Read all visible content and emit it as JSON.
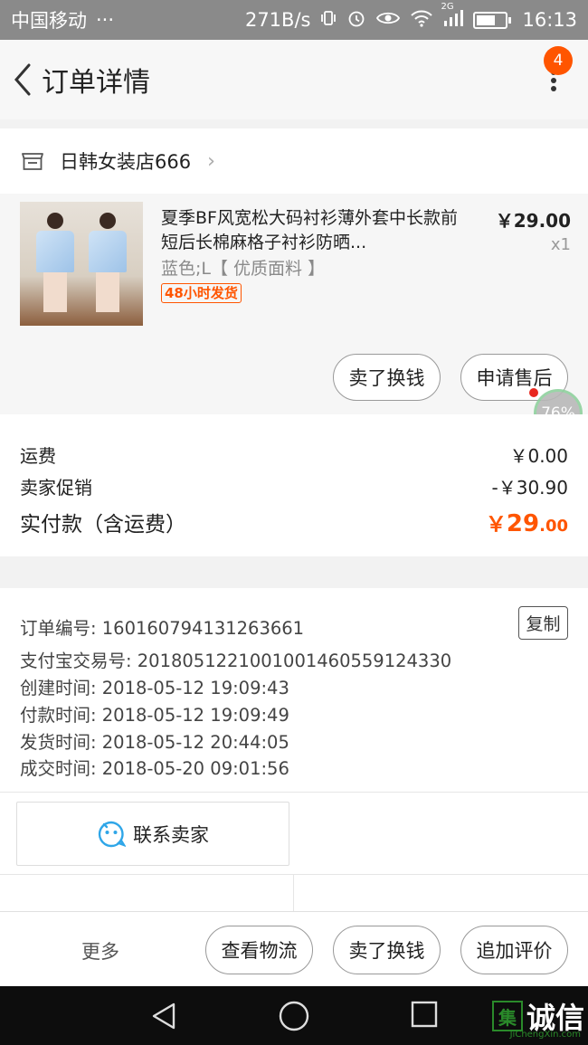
{
  "status_bar": {
    "carrier": "中国移动",
    "dots": "···",
    "speed": "271B/s",
    "network": "2G",
    "time": "16:13"
  },
  "header": {
    "title": "订单详情",
    "badge_count": "4"
  },
  "shop": {
    "name": "日韩女装店666",
    "arrow": "›"
  },
  "product": {
    "title": "夏季BF风宽松大码衬衫薄外套中长款前短后长棉麻格子衬衫防晒...",
    "sku": "蓝色;L【 优质面料 】",
    "tag": "48小时发货",
    "price": "￥29.00",
    "quantity": "x1",
    "btn_sell": "卖了换钱",
    "btn_aftersale": "申请售后"
  },
  "floating_ball": {
    "percent": "76%"
  },
  "summary": {
    "shipping_label": "运费",
    "shipping_value": "￥0.00",
    "promo_label": "卖家促销",
    "promo_value": "-￥30.90",
    "total_label": "实付款（含运费）",
    "total_currency": "￥",
    "total_int": "29",
    "total_dec": ".00"
  },
  "order_info": {
    "order_no": "订单编号: 160160794131263661",
    "alipay_no": "支付宝交易号: 2018051221001001460559124330",
    "created": "创建时间: 2018-05-12 19:09:43",
    "paid": "付款时间: 2018-05-12 19:09:49",
    "shipped": "发货时间: 2018-05-12 20:44:05",
    "completed": "成交时间: 2018-05-20 09:01:56",
    "copy_label": "复制"
  },
  "contact": {
    "label": "联系卖家"
  },
  "action_bar": {
    "more": "更多",
    "logistics": "查看物流",
    "sell": "卖了换钱",
    "review": "追加评价"
  },
  "watermark": {
    "box": "集",
    "text": "诚信",
    "sub": "JiChengXin.com"
  },
  "colors": {
    "accent": "#ff5500",
    "text": "#222222",
    "muted": "#8a8a8a"
  }
}
